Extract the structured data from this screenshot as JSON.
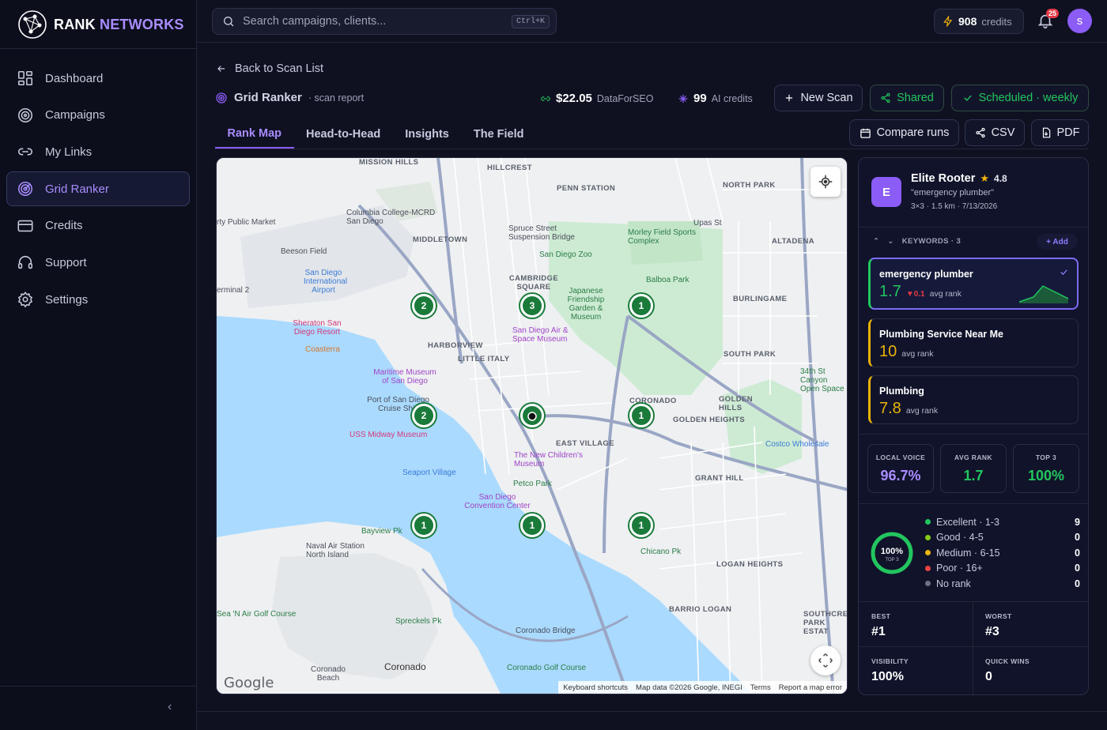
{
  "brand": {
    "part1": "RANK",
    "part2": "NETWORKS"
  },
  "sidebar": {
    "items": [
      {
        "label": "Dashboard",
        "icon": "dashboard-icon"
      },
      {
        "label": "Campaigns",
        "icon": "target-icon"
      },
      {
        "label": "My Links",
        "icon": "link-icon"
      },
      {
        "label": "Grid Ranker",
        "icon": "radar-icon",
        "active": true
      },
      {
        "label": "Credits",
        "icon": "credit-card-icon"
      },
      {
        "label": "Support",
        "icon": "headset-icon"
      },
      {
        "label": "Settings",
        "icon": "gear-icon"
      }
    ],
    "collapse": "‹"
  },
  "topbar": {
    "search_placeholder": "Search campaigns, clients...",
    "shortcut": "Ctrl+K",
    "credits_value": "908",
    "credits_label": "credits",
    "notifications": "25",
    "avatar_letter": "s"
  },
  "header": {
    "back": "Back to Scan List",
    "title": "Grid Ranker",
    "subtitle": "· scan report",
    "cost_value": "$22.05",
    "cost_label": "DataForSEO",
    "ai_value": "99",
    "ai_label": "AI credits",
    "buttons": {
      "new_scan": "New Scan",
      "shared": "Shared",
      "scheduled": "Scheduled · weekly",
      "compare": "Compare runs",
      "csv": "CSV",
      "pdf": "PDF"
    }
  },
  "tabs": [
    "Rank Map",
    "Head-to-Head",
    "Insights",
    "The Field"
  ],
  "map": {
    "pins": [
      "2",
      "3",
      "1",
      "2",
      "1",
      "1",
      "1",
      "1"
    ],
    "labels": {
      "mission_hills": "MISSION HILLS",
      "hillcrest": "HILLCREST",
      "penn_station": "PENN STATION",
      "north_park": "NORTH PARK",
      "middletown": "MIDDLETOWN",
      "altadena": "ALTADENA",
      "cambridge": "CAMBRIDGE SQUARE",
      "burlingame": "BURLINGAME",
      "harborview": "HARBORVIEW",
      "little_italy": "LITTLE ITALY",
      "south_park": "SOUTH PARK",
      "golden_hills": "GOLDEN HILLS",
      "coronado_top": "CORONADO",
      "golden_heights": "GOLDEN HEIGHTS",
      "east_village": "EAST VILLAGE",
      "grant_hill": "GRANT HILL",
      "logan_heights": "LOGAN HEIGHTS",
      "barrio_logan": "BARRIO LOGAN",
      "southcrest": "SOUTHCREST PARK ESTAT",
      "coronado": "Coronado",
      "coronado_beach": "Coronado Beach",
      "columbia": "Columbia College-MCRD San Diego",
      "public_market": "rty Public Market",
      "spruce": "Spruce Street Suspension Bridge",
      "morley": "Morley Field Sports Complex",
      "upas": "Upas St",
      "zoo": "San Diego Zoo",
      "balboa": "Balboa Park",
      "beeson": "Beeson Field",
      "airport": "San Diego International Airport",
      "terminal": "erminal 2",
      "japanese": "Japanese Friendship Garden & Museum",
      "sheraton": "Sheraton San Diego Resort",
      "coasterra": "Coasterra",
      "air_space": "San Diego Air & Space Museum",
      "maritime": "Maritime Museum of San Diego",
      "cruise": "Port of San Diego Cruise Ship Te",
      "midway": "USS Midway Museum",
      "new_children": "The New Children's Museum",
      "seaport": "Seaport Village",
      "petco": "Petco Park",
      "convention": "San Diego Convention Center",
      "bayview": "Bayview Pk",
      "naval": "Naval Air Station North Island",
      "chicano": "Chicano Pk",
      "costco": "Costco Wholesale",
      "open_space": "34th St Canyon Open Space",
      "sea_golf": "Sea 'N Air Golf Course",
      "spreckels": "Spreckels Pk",
      "coronado_bridge": "Coronado Bridge",
      "coronado_golf": "Coronado Golf Course"
    },
    "attribution": [
      "Keyboard shortcuts",
      "Map data ©2026 Google, INEGI",
      "Terms",
      "Report a map error"
    ],
    "google": "Google"
  },
  "panel": {
    "avatar": "E",
    "business": "Elite Rooter",
    "rating": "4.8",
    "keyword": "\"emergency plumber\"",
    "meta": "3×3 · 1.5 km · 7/13/2026",
    "keywords_header": "KEYWORDS · 3",
    "add": "+ Add",
    "keywords": [
      {
        "name": "emergency plumber",
        "rank": "1.7",
        "delta": "▼0.1",
        "label": "avg rank"
      },
      {
        "name": "Plumbing Service Near Me",
        "rank": "10",
        "label": "avg rank"
      },
      {
        "name": "Plumbing",
        "rank": "7.8",
        "label": "avg rank"
      }
    ],
    "stats": [
      {
        "title": "LOCAL VOICE",
        "value": "96.7%",
        "color": "#a98cff"
      },
      {
        "title": "AVG RANK",
        "value": "1.7",
        "color": "#22c55e"
      },
      {
        "title": "TOP 3",
        "value": "100%",
        "color": "#22c55e"
      }
    ],
    "ring": {
      "value": "100%",
      "label": "TOP 3",
      "fraction": 1.0
    },
    "distribution": [
      {
        "label": "Excellent · 1-3",
        "count": "9",
        "color": "#22c55e"
      },
      {
        "label": "Good · 4-5",
        "count": "0",
        "color": "#84cc16"
      },
      {
        "label": "Medium · 6-15",
        "count": "0",
        "color": "#eab308"
      },
      {
        "label": "Poor · 16+",
        "count": "0",
        "color": "#ef4444"
      },
      {
        "label": "No rank",
        "count": "0",
        "color": "#6b7280"
      }
    ],
    "summary": [
      {
        "title": "BEST",
        "value": "#1"
      },
      {
        "title": "WORST",
        "value": "#3"
      },
      {
        "title": "VISIBILITY",
        "value": "100%"
      },
      {
        "title": "QUICK WINS",
        "value": "0"
      }
    ]
  }
}
